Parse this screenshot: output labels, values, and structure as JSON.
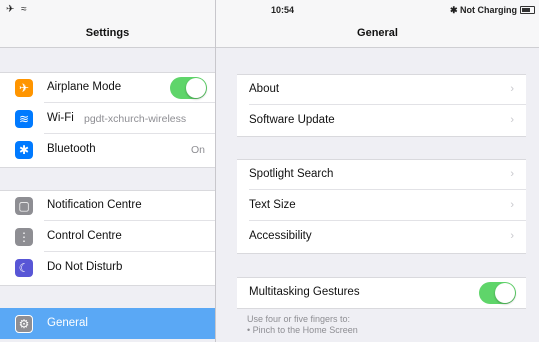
{
  "status_bar": {
    "left_icons": "✈ ≈",
    "time": "10:54",
    "bluetooth_symbol": "✱",
    "charging_text": "Not Charging"
  },
  "master": {
    "title": "Settings",
    "group1": [
      {
        "label": "Airplane Mode",
        "icon": "airplane-icon",
        "color": "#ff9500",
        "glyph": "✈",
        "toggle": true
      },
      {
        "label": "Wi-Fi",
        "icon": "wifi-icon",
        "color": "#007aff",
        "glyph": "≋",
        "value": "pgdt-xchurch-wireless"
      },
      {
        "label": "Bluetooth",
        "icon": "bluetooth-icon",
        "color": "#007aff",
        "glyph": "✱",
        "value": "On"
      }
    ],
    "group2": [
      {
        "label": "Notification Centre",
        "icon": "notification-centre-icon",
        "color": "#8e8e93",
        "glyph": "▢"
      },
      {
        "label": "Control Centre",
        "icon": "control-centre-icon",
        "color": "#8e8e93",
        "glyph": "⋮"
      },
      {
        "label": "Do Not Disturb",
        "icon": "moon-icon",
        "color": "#5856d6",
        "glyph": "☾"
      }
    ],
    "selected": {
      "label": "General",
      "icon": "gear-icon",
      "glyph": "⚙"
    }
  },
  "detail": {
    "title": "General",
    "group1": [
      {
        "label": "About"
      },
      {
        "label": "Software Update"
      }
    ],
    "group2": [
      {
        "label": "Spotlight Search"
      },
      {
        "label": "Text Size"
      },
      {
        "label": "Accessibility"
      }
    ],
    "group3": {
      "label": "Multitasking Gestures",
      "toggle": true
    },
    "footnote_lines": [
      "Use four or five fingers to:",
      "• Pinch to the Home Screen"
    ],
    "chevron": "›"
  },
  "colors": {
    "accent": "#5aa8f5",
    "toggle_on": "#5fd56a"
  }
}
